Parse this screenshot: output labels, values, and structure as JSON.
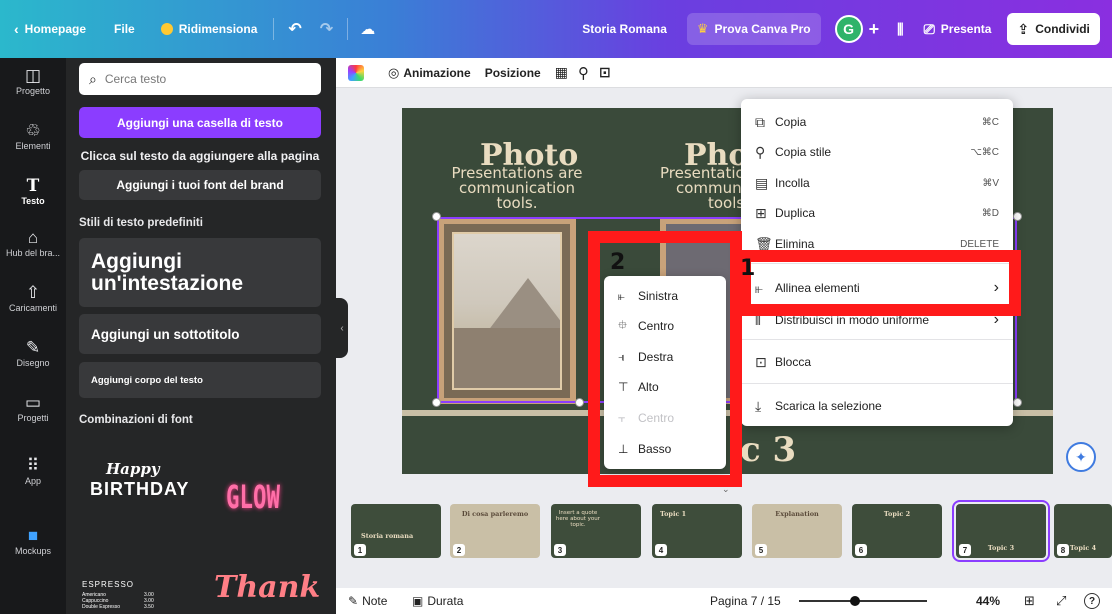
{
  "topbar": {
    "home": "Homepage",
    "file": "File",
    "resize": "Ridimensiona",
    "doc_title": "Storia Romana",
    "pro": "Prova Canva Pro",
    "avatar": "G",
    "plus": "+",
    "present": "Presenta",
    "share": "Condividi"
  },
  "rail": {
    "items": [
      {
        "label": "Progetto",
        "icon": "layout-icon"
      },
      {
        "label": "Elementi",
        "icon": "elements-icon"
      },
      {
        "label": "Testo",
        "icon": "text-icon"
      },
      {
        "label": "Hub del bra...",
        "icon": "brand-hub-icon"
      },
      {
        "label": "Caricamenti",
        "icon": "upload-icon"
      },
      {
        "label": "Disegno",
        "icon": "draw-icon"
      },
      {
        "label": "Progetti",
        "icon": "folder-icon"
      },
      {
        "label": "App",
        "icon": "apps-icon"
      },
      {
        "label": "Mockups",
        "icon": "mockups-icon"
      }
    ]
  },
  "panel": {
    "search_placeholder": "Cerca testo",
    "add_textbox": "Aggiungi una casella di testo",
    "click_hint": "Clicca sul testo da aggiungere alla pagina",
    "brand_fonts": "Aggiungi i tuoi font del brand",
    "default_styles": "Stili di testo predefiniti",
    "heading": "Aggiungi un'intestazione",
    "subheading": "Aggiungi un sottotitolo",
    "body": "Aggiungi corpo del testo",
    "font_combos": "Combinazioni di font",
    "combo_happy": "Happy",
    "combo_birthday": "BIRTHDAY",
    "combo_glow": "GLOW",
    "combo_espresso": "ESPRESSO",
    "combo_menu": [
      {
        "item": "Americano",
        "price": "3.00"
      },
      {
        "item": "Cappuccino",
        "price": "3.00"
      },
      {
        "item": "Double Espresso",
        "price": "3.50"
      }
    ],
    "combo_thank": "Thank"
  },
  "toolbar": {
    "animation": "Animazione",
    "position": "Posizione"
  },
  "slide": {
    "title1": "Photo",
    "sub1": "Presentations are communication tools.",
    "title2": "Phot",
    "sub2a": "Presentatio",
    "sub2b": "communi",
    "sub2c": "tools",
    "big": "c 3"
  },
  "context_menu": {
    "items": [
      {
        "label": "Copia",
        "shortcut": "⌘C"
      },
      {
        "label": "Copia stile",
        "shortcut": "⌥⌘C"
      },
      {
        "label": "Incolla",
        "shortcut": "⌘V"
      },
      {
        "label": "Duplica",
        "shortcut": "⌘D"
      },
      {
        "label": "Elimina",
        "shortcut": "DELETE"
      },
      {
        "label": "Allinea elementi",
        "shortcut": "›"
      },
      {
        "label": "Distribuisci in modo uniforme",
        "shortcut": "›"
      },
      {
        "label": "Blocca",
        "shortcut": ""
      },
      {
        "label": "Scarica la selezione",
        "shortcut": ""
      }
    ]
  },
  "submenu": {
    "items": [
      {
        "label": "Sinistra",
        "enabled": true
      },
      {
        "label": "Centro",
        "enabled": true
      },
      {
        "label": "Destra",
        "enabled": true
      },
      {
        "label": "Alto",
        "enabled": true
      },
      {
        "label": "Centro",
        "enabled": false
      },
      {
        "label": "Basso",
        "enabled": true
      }
    ]
  },
  "annotations": {
    "label1": "1",
    "label2": "2",
    "color": "#ff1a1a"
  },
  "filmstrip": {
    "slides": [
      {
        "num": "1",
        "title": "Storia romana"
      },
      {
        "num": "2",
        "title": "Di cosa parleremo"
      },
      {
        "num": "3",
        "title": "Insert a quote here about your topic."
      },
      {
        "num": "4",
        "title": "Topic 1"
      },
      {
        "num": "5",
        "title": "Explanation"
      },
      {
        "num": "6",
        "title": "Topic 2"
      },
      {
        "num": "7",
        "title": "Topic 3"
      },
      {
        "num": "8",
        "title": "Topic 4"
      }
    ],
    "selected": 7
  },
  "bottombar": {
    "notes": "Note",
    "duration": "Durata",
    "page": "Pagina 7 / 15",
    "zoom": "44%",
    "zoom_fraction": 0.44,
    "help": "?"
  },
  "colors": {
    "accent": "#8b3dff",
    "slide_bg": "#3a4a3a",
    "slide_text": "#e9dcc0"
  }
}
